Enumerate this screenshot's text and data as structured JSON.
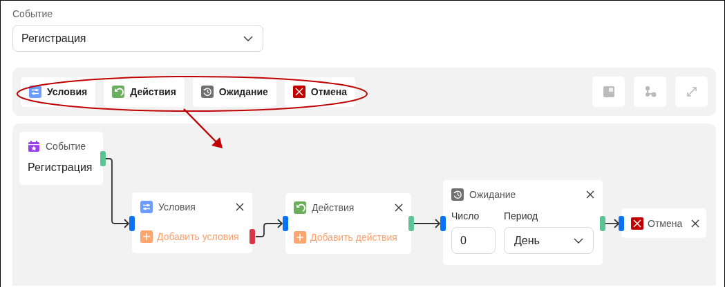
{
  "event_field": {
    "label": "Событие",
    "value": "Регистрация"
  },
  "palette": [
    {
      "kind": "conditions",
      "label": "Условия"
    },
    {
      "kind": "actions",
      "label": "Действия"
    },
    {
      "kind": "wait",
      "label": "Ожидание"
    },
    {
      "kind": "cancel",
      "label": "Отмена"
    }
  ],
  "nodes": [
    {
      "kind": "event",
      "title": "Событие",
      "value": "Регистрация",
      "ports": [
        {
          "kind": "output",
          "color": "#5cc494"
        }
      ]
    },
    {
      "kind": "conditions",
      "title": "Условия",
      "add_label": "Добавить условия",
      "ports": [
        {
          "kind": "input",
          "color": "#0a73f5"
        },
        {
          "kind": "output",
          "color": "#dc3545"
        }
      ]
    },
    {
      "kind": "actions",
      "title": "Действия",
      "add_label": "Добавить действия",
      "ports": [
        {
          "kind": "input",
          "color": "#0a73f5"
        },
        {
          "kind": "output",
          "color": "#5cc494"
        }
      ]
    },
    {
      "kind": "wait",
      "title": "Ожидание",
      "number_label": "Число",
      "number_value": "0",
      "period_label": "Период",
      "period_value": "День",
      "ports": [
        {
          "kind": "input",
          "color": "#0a73f5"
        },
        {
          "kind": "output",
          "color": "#5cc494"
        }
      ]
    },
    {
      "kind": "cancel",
      "title": "Отмена",
      "ports": [
        {
          "kind": "input",
          "color": "#0a73f5"
        }
      ]
    }
  ]
}
